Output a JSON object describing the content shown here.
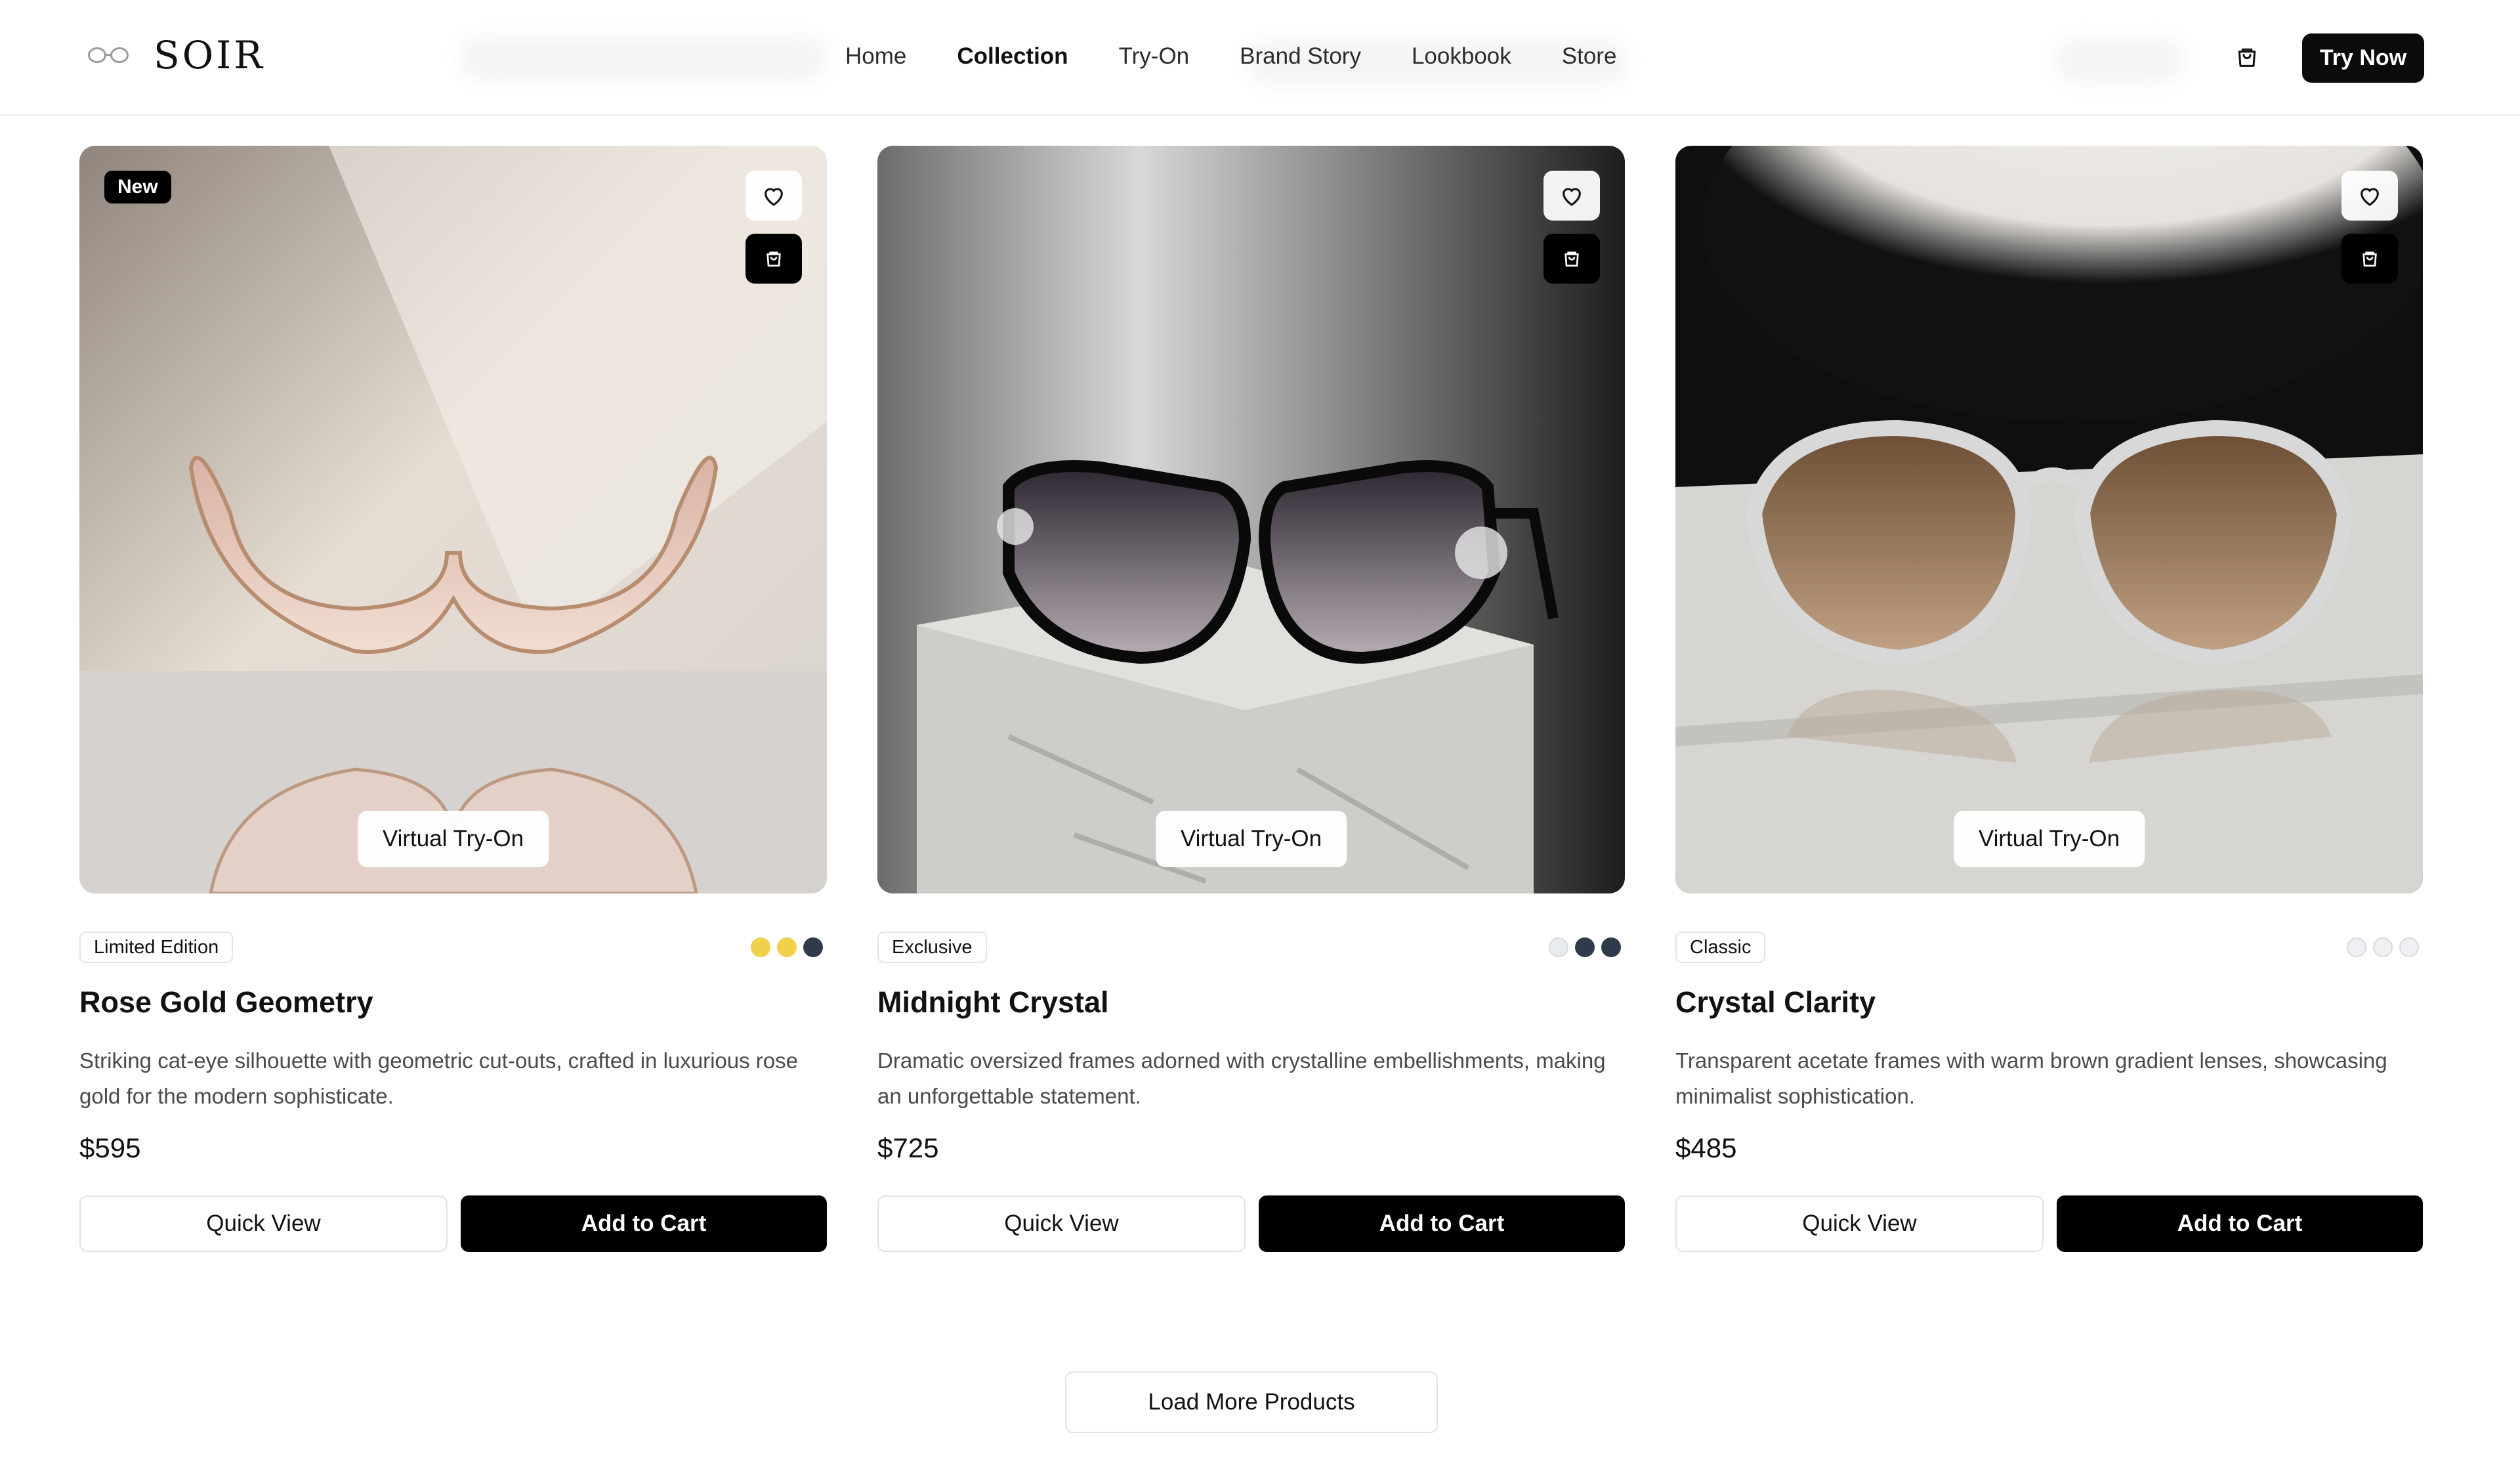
{
  "brand": {
    "name": "SOIR",
    "logo_icon": "glasses-logo-icon"
  },
  "nav": {
    "items": [
      {
        "label": "Home",
        "active": false
      },
      {
        "label": "Collection",
        "active": true
      },
      {
        "label": "Try-On",
        "active": false
      },
      {
        "label": "Brand Story",
        "active": false
      },
      {
        "label": "Lookbook",
        "active": false
      },
      {
        "label": "Store",
        "active": false
      }
    ],
    "cart_icon": "shopping-bag-icon",
    "cta_label": "Try Now"
  },
  "products": [
    {
      "badge": "New",
      "tag": "Limited Edition",
      "swatches": [
        "#f1d04b",
        "#f1d04b",
        "#2f3a4a"
      ],
      "name": "Rose Gold Geometry",
      "description": "Striking cat-eye silhouette with geometric cut-outs, crafted in luxurious rose gold for the modern sophisticate.",
      "price": "$595",
      "try_on_label": "Virtual Try-On",
      "quick_view_label": "Quick View",
      "add_to_cart_label": "Add to Cart"
    },
    {
      "badge": "",
      "tag": "Exclusive",
      "swatches": [
        "#e9ecef",
        "#2f3a4a",
        "#2f3a4a"
      ],
      "name": "Midnight Crystal",
      "description": "Dramatic oversized frames adorned with crystalline embellishments, making an unforgettable statement.",
      "price": "$725",
      "try_on_label": "Virtual Try-On",
      "quick_view_label": "Quick View",
      "add_to_cart_label": "Add to Cart"
    },
    {
      "badge": "",
      "tag": "Classic",
      "swatches": [
        "#eef0f2",
        "#eef0f2",
        "#eef0f2"
      ],
      "name": "Crystal Clarity",
      "description": "Transparent acetate frames with warm brown gradient lenses, showcasing minimalist sophistication.",
      "price": "$485",
      "try_on_label": "Virtual Try-On",
      "quick_view_label": "Quick View",
      "add_to_cart_label": "Add to Cart"
    }
  ],
  "load_more_label": "Load More Products",
  "icons": {
    "favorite": "heart-icon",
    "bag": "shopping-bag-icon"
  }
}
